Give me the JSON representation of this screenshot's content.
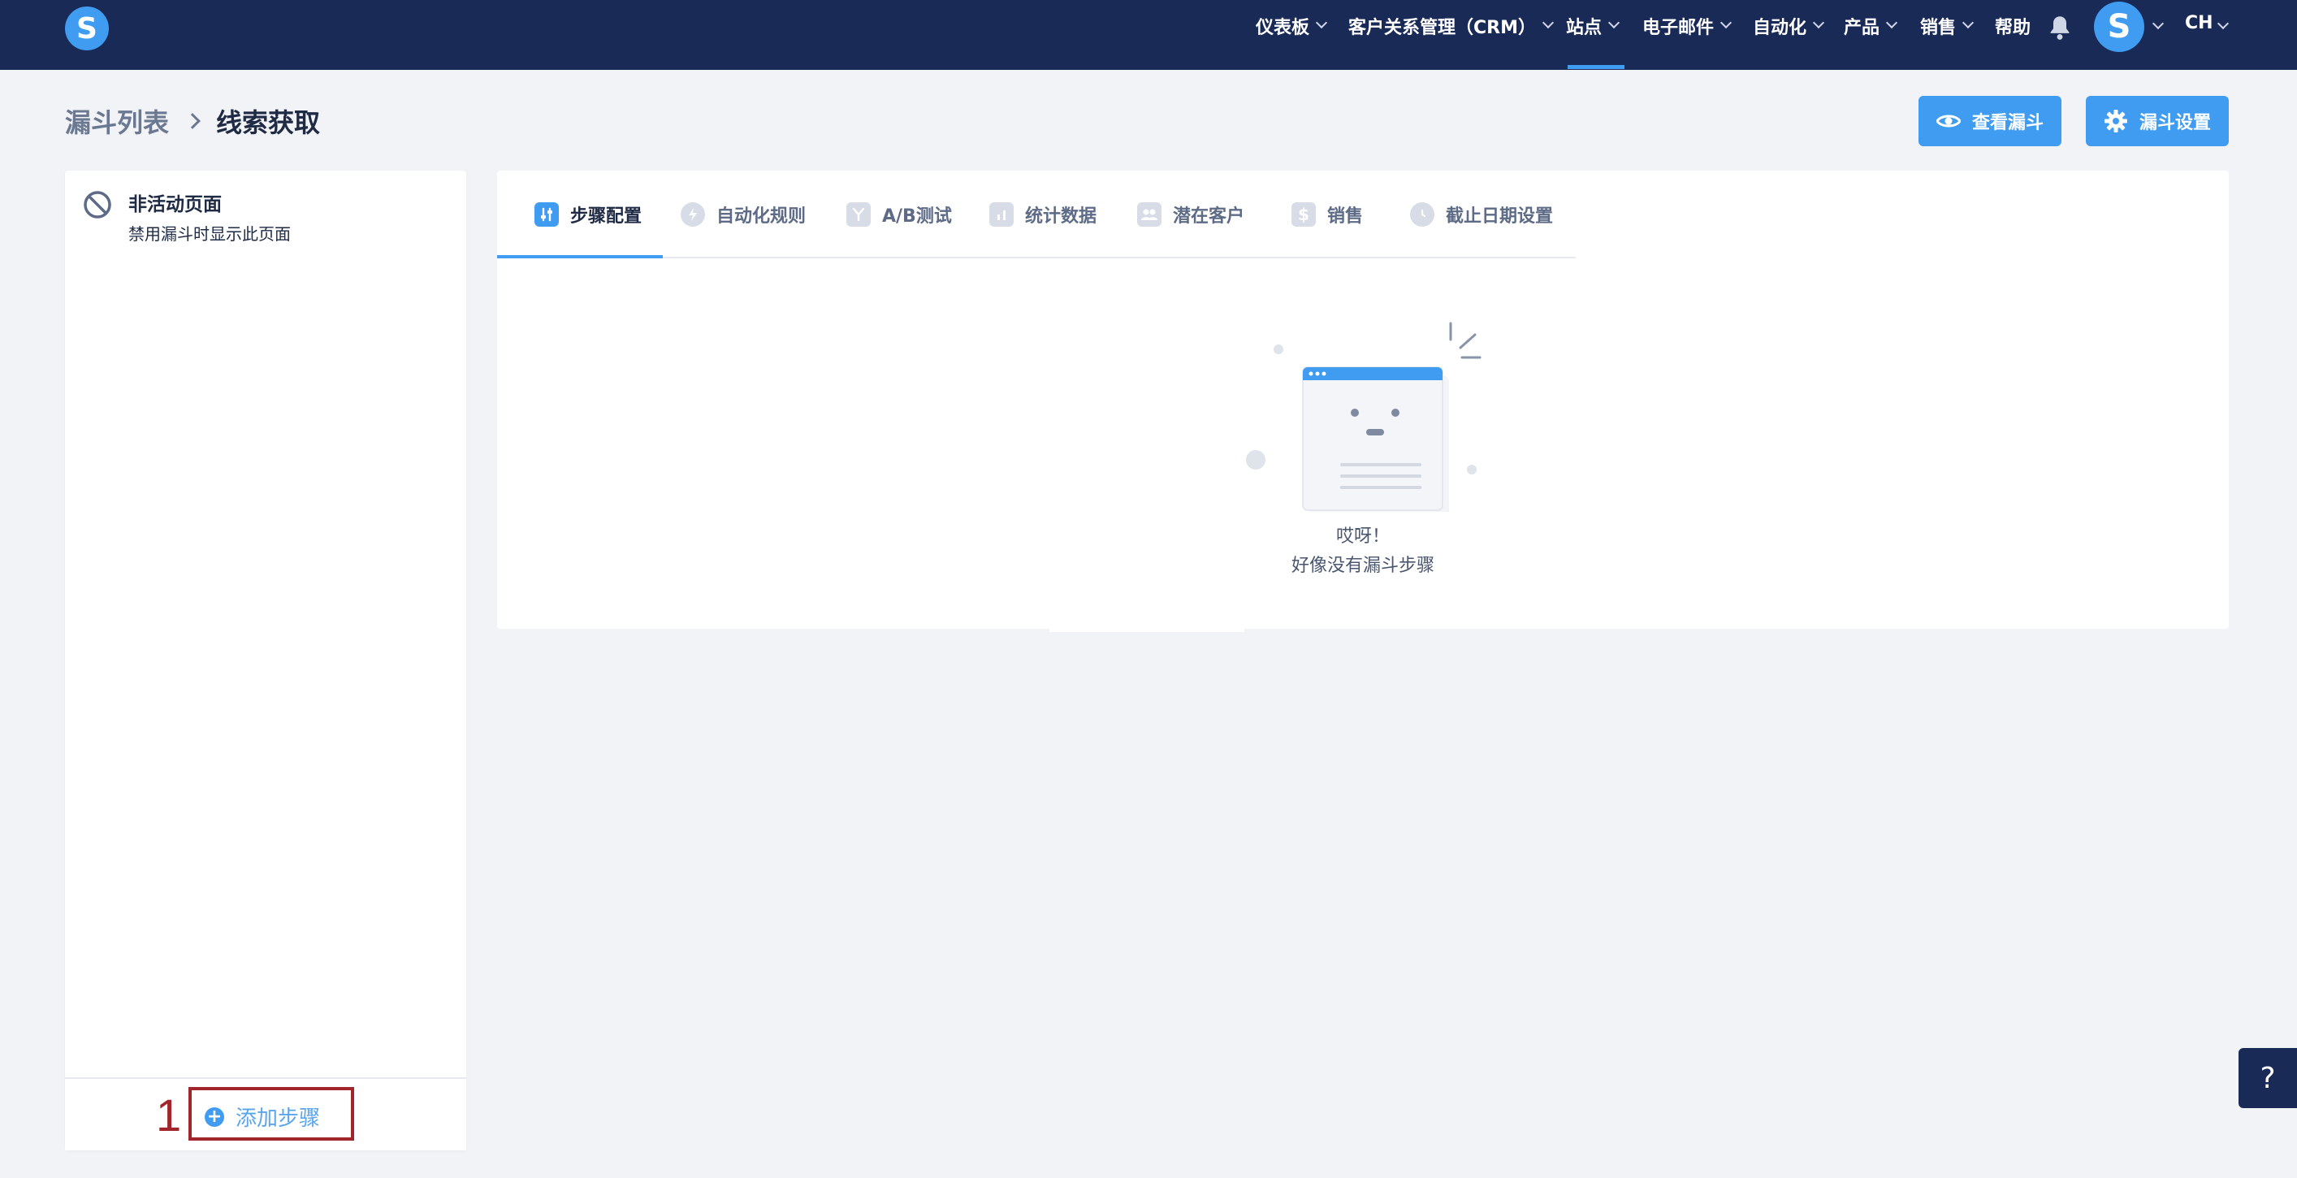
{
  "app": {
    "logo_letter": "S"
  },
  "nav": {
    "items": [
      {
        "label": "仪表板",
        "has_dropdown": true
      },
      {
        "label": "客户关系管理（CRM）",
        "has_dropdown": true
      },
      {
        "label": "站点",
        "has_dropdown": true,
        "active": true
      },
      {
        "label": "电子邮件",
        "has_dropdown": true
      },
      {
        "label": "自动化",
        "has_dropdown": true
      },
      {
        "label": "产品",
        "has_dropdown": true
      },
      {
        "label": "销售",
        "has_dropdown": true
      },
      {
        "label": "帮助",
        "has_dropdown": false
      }
    ],
    "bell_icon": "bell-icon",
    "avatar_letter": "S",
    "language": "CH"
  },
  "breadcrumb": {
    "parent": "漏斗列表",
    "current": "线索获取"
  },
  "actions": {
    "view_funnel": "查看漏斗",
    "funnel_settings": "漏斗设置"
  },
  "sidebar": {
    "inactive_title": "非活动页面",
    "inactive_subtitle": "禁用漏斗时显示此页面",
    "step_marker": "1",
    "add_step": "添加步骤"
  },
  "tabs": [
    {
      "label": "步骤配置",
      "icon": "sliders-icon",
      "active": true
    },
    {
      "label": "自动化规则",
      "icon": "bolt-icon"
    },
    {
      "label": "A/B测试",
      "icon": "split-icon"
    },
    {
      "label": "统计数据",
      "icon": "bar-chart-icon"
    },
    {
      "label": "潜在客户",
      "icon": "users-icon"
    },
    {
      "label": "销售",
      "icon": "dollar-icon"
    },
    {
      "label": "截止日期设置",
      "icon": "clock-icon"
    }
  ],
  "empty_state": {
    "title": "哎呀！",
    "message": "好像没有漏斗步骤"
  },
  "help": {
    "label": "?"
  },
  "colors": {
    "navbar": "#1a2a57",
    "accent": "#3f9cf1",
    "background": "#f1f3f7",
    "annotation": "#a0262b"
  }
}
